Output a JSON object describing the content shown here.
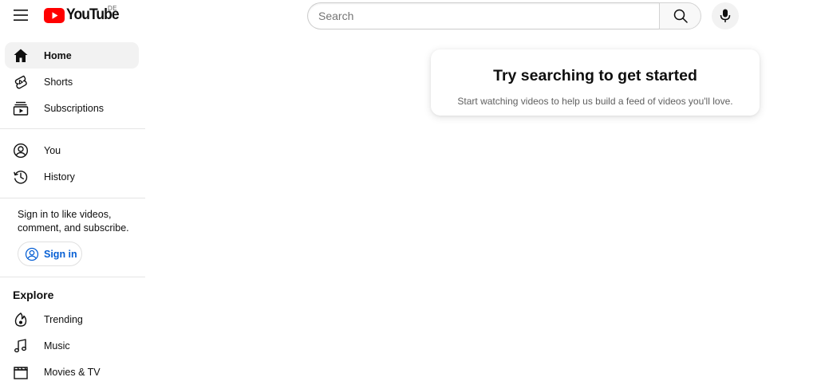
{
  "header": {
    "logo_text": "YouTube",
    "country_code": "DE",
    "search": {
      "placeholder": "Search",
      "value": ""
    }
  },
  "sidebar": {
    "primary": [
      {
        "label": "Home",
        "icon": "home-icon",
        "active": true
      },
      {
        "label": "Shorts",
        "icon": "shorts-icon",
        "active": false
      },
      {
        "label": "Subscriptions",
        "icon": "subscriptions-icon",
        "active": false
      }
    ],
    "you": [
      {
        "label": "You",
        "icon": "account-icon"
      },
      {
        "label": "History",
        "icon": "history-icon"
      }
    ],
    "signin_prompt": "Sign in to like videos, comment, and subscribe.",
    "signin_button": "Sign in",
    "explore_title": "Explore",
    "explore": [
      {
        "label": "Trending",
        "icon": "trending-icon"
      },
      {
        "label": "Music",
        "icon": "music-icon"
      },
      {
        "label": "Movies & TV",
        "icon": "movies-icon"
      }
    ]
  },
  "main": {
    "empty_state": {
      "title": "Try searching to get started",
      "subtitle": "Start watching videos to help us build a feed of videos you'll love."
    }
  },
  "colors": {
    "brand_red": "#ff0000",
    "link_blue": "#065fd4",
    "active_bg": "#f2f2f2"
  }
}
